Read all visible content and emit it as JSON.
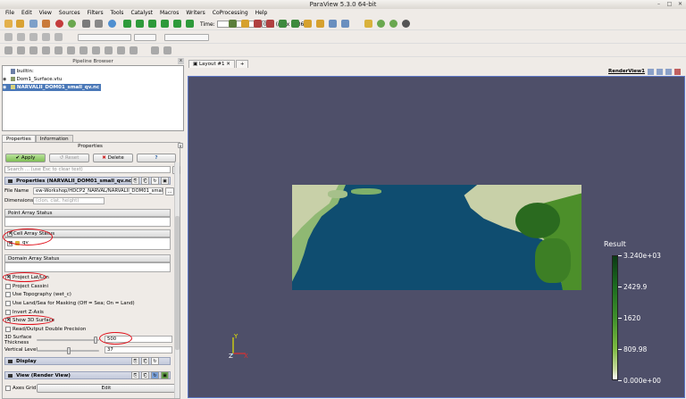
{
  "window": {
    "title": "ParaView 5.3.0 64-bit",
    "btn_min": "–",
    "btn_max": "□",
    "btn_close": "✕"
  },
  "menu": [
    "File",
    "Edit",
    "View",
    "Sources",
    "Filters",
    "Tools",
    "Catalyst",
    "Macros",
    "Writers",
    "CoProcessing",
    "Help"
  ],
  "toolbar": {
    "time_label": "Time:",
    "time_index": "0",
    "time_max": "(max is 36)"
  },
  "pipeline_browser": {
    "title": "Pipeline Browser",
    "items": [
      "builtin:",
      "Dom1_Surface.vtu",
      "NARVALII_DOM01_small_qv.nc"
    ]
  },
  "properties": {
    "tabs": [
      "Properties",
      "Information"
    ],
    "header": "Properties",
    "apply": "Apply",
    "reset": "Reset",
    "delete": "Delete",
    "help": "?",
    "search_placeholder": "Search ... (use Esc to clear text)",
    "section_title": "Properties (NARVALII_DOM01_small_qv.nc)",
    "file_name_label": "File Name",
    "file_name_value": "ew-Workshop/HDCP2_NARVAL/NARVALII_DOM01_small_qv.nc",
    "file_browse": "...",
    "dimensions_label": "Dimensions",
    "dimensions_value": "(clon, clat, height)",
    "point_array_status": "Point Array Status",
    "cell_array_status": "Cell Array Status",
    "cell_array_item": "qv",
    "domain_array_status": "Domain Array Status",
    "checks": [
      "Project Lat/Lon",
      "Project Cassini",
      "Use Topography (wet_c)",
      "Use Land/Sea for Masking (Off = Sea; On = Land)",
      "Invert Z-Axis",
      "Show 3D Surface",
      "Read/Output Double Precision"
    ],
    "checked": [
      true,
      false,
      false,
      false,
      false,
      true,
      false
    ],
    "surface_thickness_label": "3D Surface Thickness",
    "surface_thickness_value": "500",
    "vertical_level_label": "Vertical Level",
    "vertical_level_value": "37",
    "display_section": "Display",
    "view_section": "View (Render View)",
    "axes_grid_label": "Axes Grid",
    "edit_button": "Edit"
  },
  "layout": {
    "tab": "Layout #1",
    "add_tab": "+",
    "view_name": "RenderView1"
  },
  "legend": {
    "title": "Result",
    "ticks": [
      "3.240e+03",
      "2429.9",
      "1620",
      "809.98",
      "0.000e+00"
    ]
  },
  "axes": {
    "y": "Y",
    "z": "Z",
    "x": "X"
  },
  "colors": {
    "background": "#4e4f69",
    "ocean": "#0f4d70",
    "land_light": "#c8d0a8",
    "land_green": "#4c8f2a",
    "highlight": "#e0101b"
  }
}
